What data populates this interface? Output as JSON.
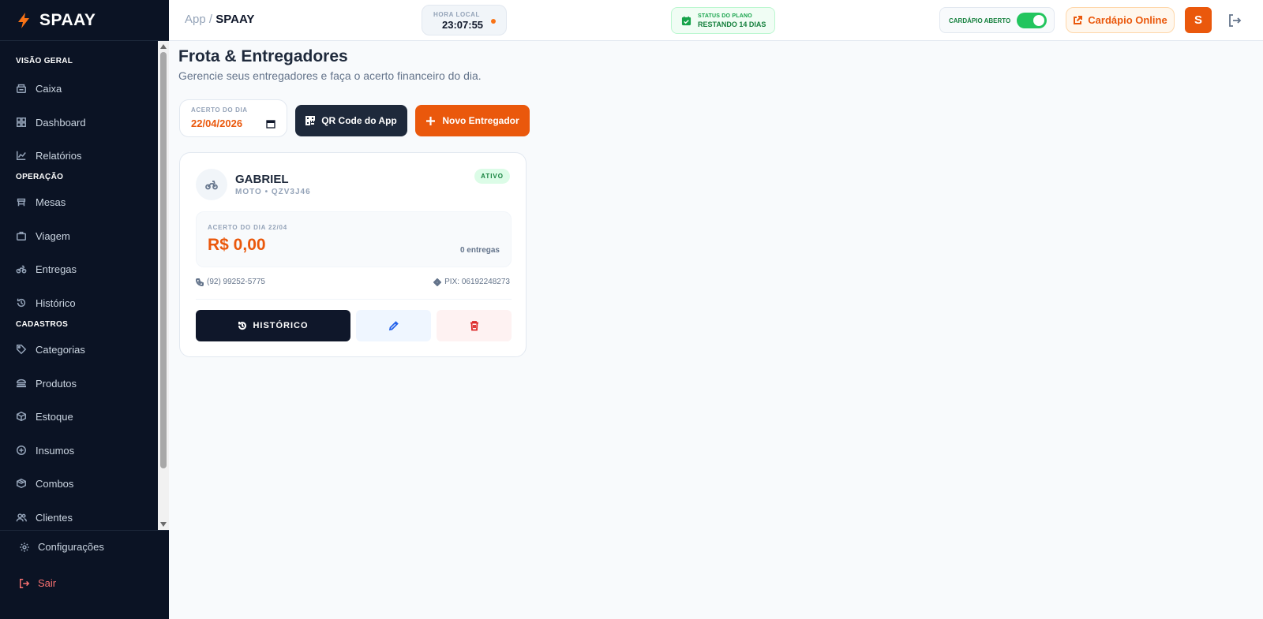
{
  "brand": {
    "name": "SPAAY",
    "icon": "bolt-icon",
    "accent": "#ea580c"
  },
  "sidebar": {
    "sections": [
      {
        "label": "VISÃO GERAL"
      },
      {
        "label": "OPERAÇÃO"
      },
      {
        "label": "CADASTROS"
      }
    ],
    "items": [
      {
        "label": "Caixa",
        "icon": "register-icon"
      },
      {
        "label": "Dashboard",
        "icon": "grid-icon"
      },
      {
        "label": "Relatórios",
        "icon": "chart-line-icon"
      },
      {
        "label": "Mesas",
        "icon": "table-icon"
      },
      {
        "label": "Viagem",
        "icon": "bag-icon"
      },
      {
        "label": "Entregas",
        "icon": "motorcycle-icon"
      },
      {
        "label": "Histórico",
        "icon": "history-icon"
      },
      {
        "label": "Categorias",
        "icon": "tag-icon"
      },
      {
        "label": "Produtos",
        "icon": "burger-icon"
      },
      {
        "label": "Estoque",
        "icon": "box-icon"
      },
      {
        "label": "Insumos",
        "icon": "plus-circle-icon"
      },
      {
        "label": "Combos",
        "icon": "package-icon"
      },
      {
        "label": "Clientes",
        "icon": "users-icon"
      }
    ],
    "settings_label": "Configurações",
    "logout_label": "Sair"
  },
  "header": {
    "breadcrumb_root": "App",
    "breadcrumb_sep": "/",
    "breadcrumb_current": "SPAAY",
    "clock_label": "HORA LOCAL",
    "clock_time": "23:07:55",
    "plan_label": "STATUS DO PLANO",
    "plan_status": "RESTANDO 14 DIAS",
    "menu_open_label": "CARDÁPIO ABERTO",
    "menu_open": true,
    "online_menu_label": "Cardápio Online",
    "avatar_initial": "S"
  },
  "main": {
    "title": "Frota & Entregadores",
    "subtitle": "Gerencie seus entregadores e faça o acerto financeiro do dia.",
    "date_label": "ACERTO DO DIA",
    "date_value": "22/04/2026",
    "qr_button": "QR Code do App",
    "new_button": "Novo Entregador"
  },
  "drivers": [
    {
      "name": "GABRIEL",
      "vehicle": "MOTO • QZV3J46",
      "status": "ATIVO",
      "settlement_label": "ACERTO DO DIA 22/04",
      "amount": "R$ 0,00",
      "deliveries": "0 entregas",
      "phone": "(92) 99252-5775",
      "pix": "PIX: 06192248273",
      "history_button": "HISTÓRICO"
    }
  ]
}
